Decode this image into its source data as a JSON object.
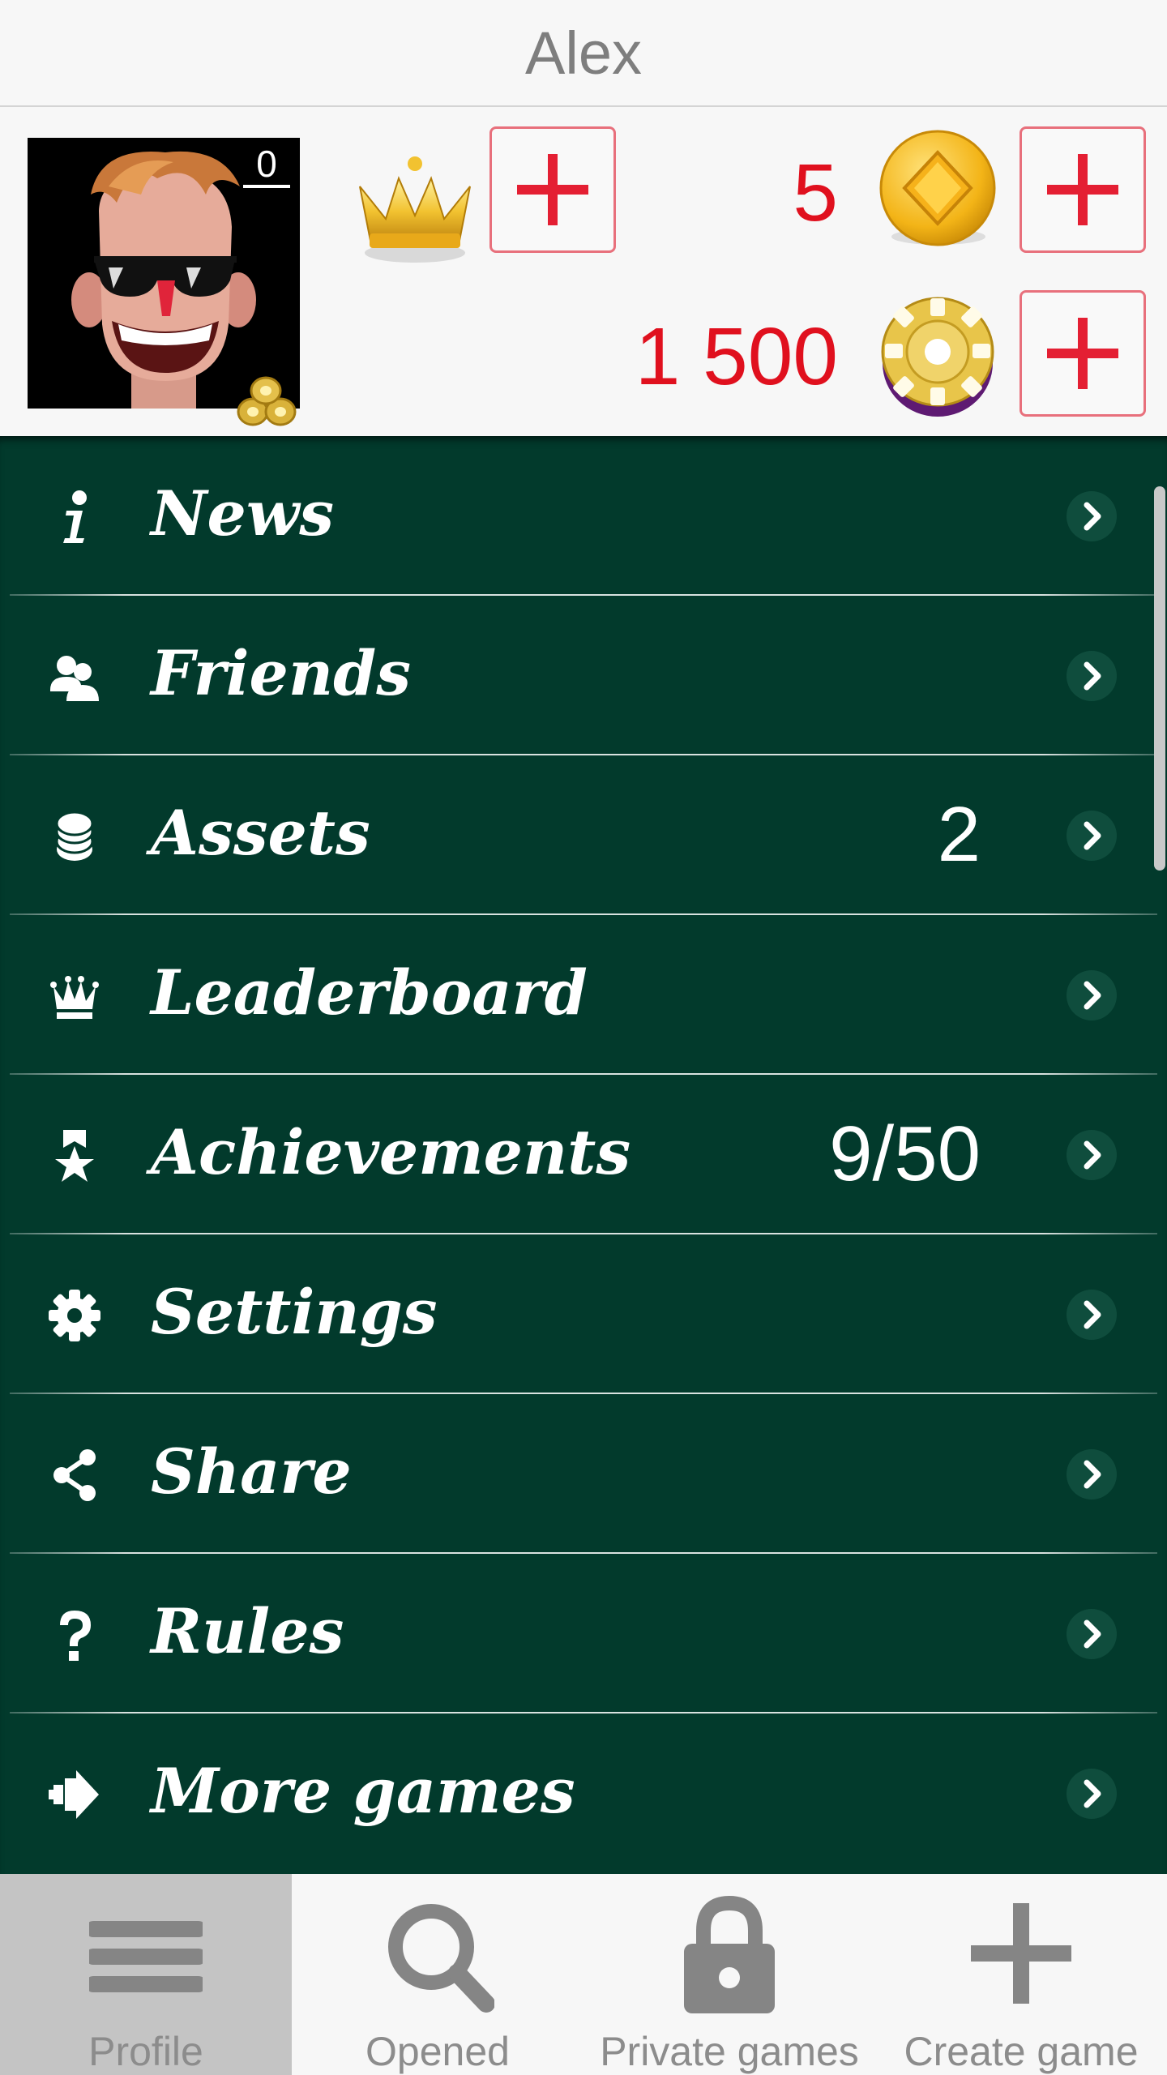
{
  "header": {
    "title": "Alex"
  },
  "profile": {
    "avatar_level": "0",
    "gems": "5",
    "chips": "1 500"
  },
  "menu": {
    "items": [
      {
        "label": "News",
        "value": "",
        "icon": "info-icon"
      },
      {
        "label": "Friends",
        "value": "",
        "icon": "friends-icon"
      },
      {
        "label": "Assets",
        "value": "2",
        "icon": "coins-icon"
      },
      {
        "label": "Leaderboard",
        "value": "",
        "icon": "crown-icon"
      },
      {
        "label": "Achievements",
        "value": "9/50",
        "icon": "medal-icon"
      },
      {
        "label": "Settings",
        "value": "",
        "icon": "gear-icon"
      },
      {
        "label": "Share",
        "value": "",
        "icon": "share-icon"
      },
      {
        "label": "Rules",
        "value": "",
        "icon": "question-icon"
      },
      {
        "label": "More games",
        "value": "",
        "icon": "more-games-icon"
      }
    ]
  },
  "bottom_nav": {
    "tabs": [
      {
        "label": "Profile",
        "icon": "menu-icon",
        "active": true
      },
      {
        "label": "Opened",
        "icon": "search-icon",
        "active": false
      },
      {
        "label": "Private games",
        "icon": "lock-icon",
        "active": false
      },
      {
        "label": "Create game",
        "icon": "plus-icon",
        "active": false
      }
    ]
  },
  "colors": {
    "menu_background": "#023a2c",
    "currency_text": "#e0101e",
    "plus_button": "#e41f33"
  }
}
